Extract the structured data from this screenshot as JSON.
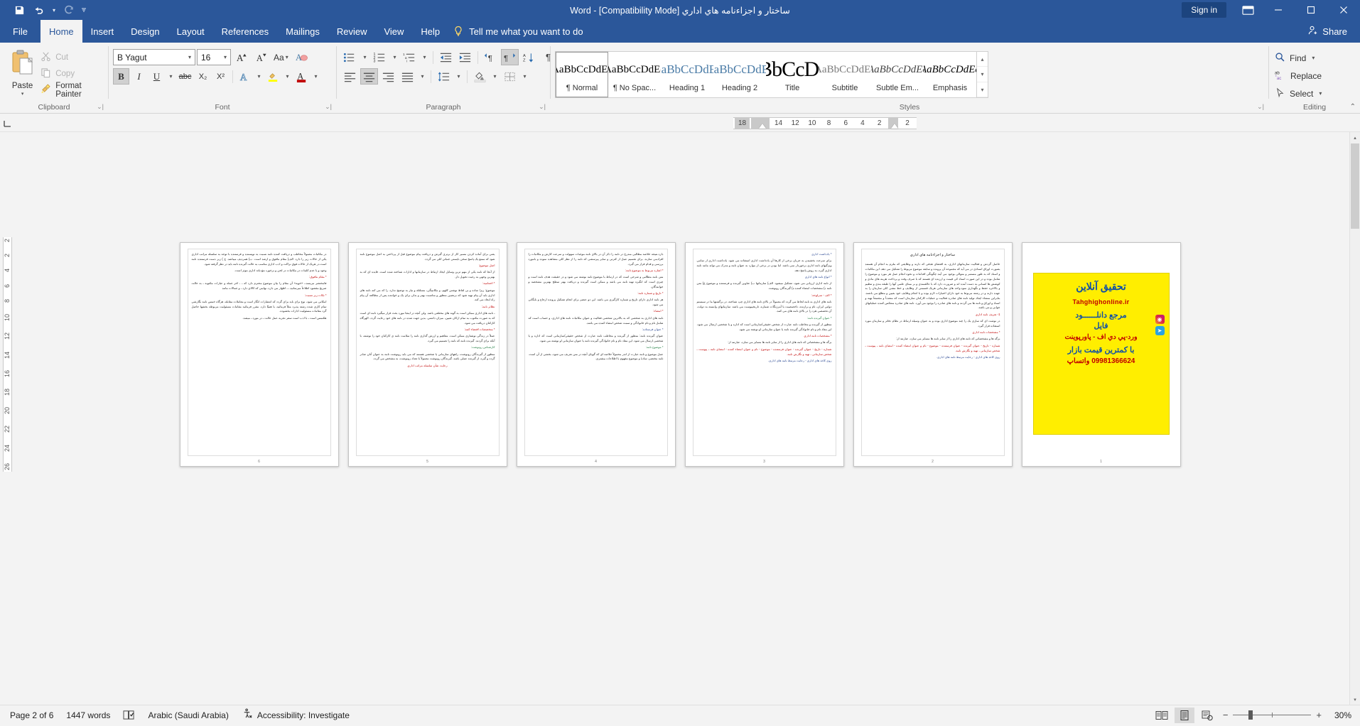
{
  "titlebar": {
    "quick_access": [
      {
        "name": "save-icon",
        "label": "Save"
      },
      {
        "name": "undo-icon",
        "label": "Undo"
      },
      {
        "name": "redo-icon",
        "label": "Redo"
      },
      {
        "name": "customize-qat-icon",
        "label": "Customize Quick Access Toolbar"
      }
    ],
    "document_title": "ساختار و اجزاءنامه هاي اداري [Compatibility Mode]  -  Word",
    "sign_in": "Sign in",
    "ribbon_display_options": "ribbon-display-options-icon",
    "minimize": "minimize-icon",
    "restore": "restore-icon",
    "close": "close-icon"
  },
  "tabs": [
    {
      "label": "File",
      "active": false
    },
    {
      "label": "Home",
      "active": true
    },
    {
      "label": "Insert",
      "active": false
    },
    {
      "label": "Design",
      "active": false
    },
    {
      "label": "Layout",
      "active": false
    },
    {
      "label": "References",
      "active": false
    },
    {
      "label": "Mailings",
      "active": false
    },
    {
      "label": "Review",
      "active": false
    },
    {
      "label": "View",
      "active": false
    },
    {
      "label": "Help",
      "active": false
    }
  ],
  "tell_me": "Tell me what you want to do",
  "share": "Share",
  "ribbon": {
    "clipboard": {
      "label": "Clipboard",
      "paste": "Paste",
      "cut": "Cut",
      "copy": "Copy",
      "format_painter": "Format Painter"
    },
    "font": {
      "label": "Font",
      "font_name": "B Yagut",
      "font_size": "16",
      "grow_font": "A",
      "shrink_font": "A",
      "change_case": "Aa",
      "clear_formatting": "clear-formatting-icon",
      "bold": "B",
      "italic": "I",
      "underline": "U",
      "strikethrough": "abc",
      "subscript": "X₂",
      "superscript": "X²",
      "text_effects": "A",
      "text_highlight": "highlight-icon",
      "font_color": "A"
    },
    "paragraph": {
      "label": "Paragraph",
      "bullets": "bullets-icon",
      "numbering": "numbering-icon",
      "multilevel": "multilevel-list-icon",
      "decrease_indent": "decrease-indent-icon",
      "increase_indent": "increase-indent-icon",
      "ltr": "left-to-right-icon",
      "rtl": "right-to-left-icon",
      "sort": "sort-icon",
      "show_marks": "¶",
      "align_left": "align-left-icon",
      "align_center": "align-center-icon",
      "align_right": "align-right-icon",
      "justify": "justify-icon",
      "line_spacing": "line-spacing-icon",
      "shading": "shading-icon",
      "borders": "borders-icon"
    },
    "styles": {
      "label": "Styles",
      "items": [
        {
          "preview": "AaBbCcDdEe",
          "name": "¶ Normal",
          "kind": "normal",
          "selected": true
        },
        {
          "preview": "AaBbCcDdEe",
          "name": "¶ No Spac...",
          "kind": "normal",
          "selected": false
        },
        {
          "preview": "AaBbCcDdEe",
          "name": "Heading 1",
          "kind": "heading",
          "selected": false
        },
        {
          "preview": "AaBbCcDdEe",
          "name": "Heading 2",
          "kind": "heading",
          "selected": false
        },
        {
          "preview": "AaBbCcDdEe",
          "name": "Title",
          "kind": "title",
          "selected": false
        },
        {
          "preview": "AaBbCcDdEe",
          "name": "Subtitle",
          "kind": "subtitle",
          "selected": false
        },
        {
          "preview": "AaBbCcDdEe",
          "name": "Subtle Em...",
          "kind": "em",
          "selected": false
        },
        {
          "preview": "AaBbCcDdEe",
          "name": "Emphasis",
          "kind": "em2",
          "selected": false
        }
      ]
    },
    "editing": {
      "label": "Editing",
      "find": "Find",
      "replace": "Replace",
      "select": "Select"
    },
    "collapse_ribbon": "collapse-ribbon-icon"
  },
  "ruler": {
    "ticks": [
      "18",
      "",
      "14",
      "12",
      "10",
      "8",
      "6",
      "4",
      "2",
      "",
      "2"
    ],
    "vertical_ticks": [
      "2",
      "2",
      "4",
      "6",
      "8",
      "10",
      "12",
      "14",
      "16",
      "18",
      "20",
      "22",
      "24",
      "26"
    ]
  },
  "statusbar": {
    "page": "Page 2 of 6",
    "words": "1447 words",
    "proofing_icon": "proofing-icon",
    "language": "Arabic (Saudi Arabia)",
    "accessibility": "Accessibility: Investigate",
    "views": [
      {
        "name": "read-mode-icon",
        "label": "Read Mode",
        "active": false
      },
      {
        "name": "print-layout-icon",
        "label": "Print Layout",
        "active": true
      },
      {
        "name": "web-layout-icon",
        "label": "Web Layout",
        "active": false
      }
    ],
    "zoom_out": "−",
    "zoom_in": "+",
    "zoom_value": "30%"
  },
  "document": {
    "pages": [
      {
        "number": "6",
        "title": "",
        "paragraphs": [
          {
            "text": "در مکاتبات معمولاً مخاطب و دریافت کننده نامه نسبت به نویسنده و فرستنده با توجه به سلسله مراتب اداری یکی از حالات زیر را دارد. الف) مقام مافوق و ارشد است.  ب) همردیف میباشد.  ج ) زیر دست فرستنده نامه است.در هریک از حالات فوق نزاکت و ادب اداری مناسب به حالت گیرنده نامه باید در نظر گرفته شود.",
            "color": "black"
          },
          {
            "text": "وجود و یا عدم کلمات در مکاتبات در لحن و برخورد مؤدبانه اداری موثر است.",
            "color": "black"
          },
          {
            "text": "* مقام مافوق:",
            "color": "red"
          },
          {
            "text": "فامختصر مریسدـ، «خویه» آن مقام را بیان موضوع محترم دارد که ـ ، اخر جمله و عبارات مکتوبه ـ به حالت صریح مقصود اطلاعاً میرسانید ـ ـ اظهار می دارد، نهایتی که کالای دارد ـ و جمالات مانند",
            "color": "black"
          },
          {
            "text": "* نکات زیر نسبت:",
            "color": "red"
          },
          {
            "text": "امکانی می شود، نوع برای باید برای گردد که انتشارات انگار است و معاملات مقابله، هرگاه خمس نامه نگارشی تمام کاری شده رشته پذیرد مثلاً فرمائید، یا همیّا دارد. مقرر فرمائید مقامات مسئولیت مربوطه بخشها حاصل گرد مقامات مسئولیت ادارات بخشوده.",
            "color": "black"
          },
          {
            "text": "هکتمس است ـ با ادب است  سفر تجربه عمل حالت ـ در مورد ـ میشد.",
            "color": "black"
          }
        ]
      },
      {
        "number": "5",
        "title": "",
        "paragraphs": [
          {
            "text": "یعنی برای آماده کردن مسیر کار از برتری گیرش و دریافت پیام موضوع قبل از پرداختن به اصل موضوع نامه شود که ممتع یک پاسخ سخن بایستی جنباتن کلی می گردد.",
            "color": "black"
          },
          {
            "text": "اصل موضوع:",
            "color": "red"
          },
          {
            "text": "از آنجا که نامه یکی از مهم ترین وسایل ایجاد ارتباط در سازمانها و ادارات شناخته شده است. فایده ای که به بهترین وجهی به رغبت تحویل دار.",
            "color": "black"
          },
          {
            "text": "* اختتامیه:",
            "color": "red"
          },
          {
            "text": "موضوع: زیرا ساده و بی لفاظ نوشتن کلهم، و مکاتیبگی، مسلئله و نیاز به توضیح ندارد. را که می کند نامه های اداری باید آن پیام تهیه شود که برتصین منظور و مناسبت بهتر و بدان برای یک و خواننده پس از مطالعه آن پیام راه ایجاد می کند.",
            "color": "black"
          },
          {
            "text": "نظائر نامه:",
            "color": "red"
          },
          {
            "text": "ـ نامه های اداری ممکن است به گونه های مختلفی باشد. ولی آنچه در اینجا مورد بحث قرار میگیرد نامه ای است که به صورت مکتوب به تمام ارکان تعیین، میزان داشتی. بدین جهت شده در نامه های خود رعایت گردد. الهرگاه کارکنان دریافت می شود.",
            "color": "black"
          },
          {
            "text": "* متخصصات اقتضاء کنند:",
            "color": "red"
          },
          {
            "text": "عملاً در زندگی نوشتاری ممکن است. مفاهیم و ارزش گذاری نامه را سلامت نامه ی کارکنان خود را نوشته، با آنکه برای گردند. گیرنده نامه که نامه را تصمیم می گیرد.",
            "color": "black"
          },
          {
            "text": "کارشناس رونوشت:",
            "color": "green"
          },
          {
            "text": "منظور از گیرندگان رونوشت، راههای سازمانی یا شخصی هستند که می باید رونوشت نامه به عنوان آنان صادر گردد و گیرد، از گیرنده عملی باشد. گیرندگان رونوشت معمولاً با تعداد  رونوشت، به مشخص می گردد.",
            "color": "black"
          },
          {
            "text": "رعایت شأن سلسله مراتب اداري",
            "color": "red"
          }
        ]
      },
      {
        "number": "4",
        "title": "",
        "paragraphs": [
          {
            "text": "دارد.نتیجه خلاصه مطالبی مندرج در نامه را ذکر آن در بالای نامه موجبات سهولت و سرعت کارش و مکاتبات را افرادمی سازند. برای تقسیم عمل از کثرتی و سایر پیرسشی که نامه را از نظر کلی مشاهده نموده و بامورد بررسی و قدام قرار می گیرد.",
            "color": "black"
          },
          {
            "text": "* اشاره مربوط به موضوع نامه:",
            "color": "red"
          },
          {
            "text": "متن نامه مطالبی و شرحی است که در ارتباط با موضوع نامه نوشته می شود و در حقیقت هدف نامه است و چیزی است که انگیزه تهیه نامه می باشد و ممکن است گیرنده و دریافت بهتر سطح بهترین مشخصه و خوانندگان.",
            "color": "black"
          },
          {
            "text": "* تاریخ و شماره نامه:",
            "color": "red"
          },
          {
            "text": "هر نامه اداری دارای تاریخ و شماره کارگیری می باشد. این دو عنصر برای انجام تشکیل پرونده ارجاع و بایگانی می شود.",
            "color": "black"
          },
          {
            "text": "* امضاء:",
            "color": "red"
          },
          {
            "text": "نامه های اداری به شخصی که به بالاترین شخصی فعالیت و عنوان مکاتبات نامه های اداری، و حساب است که شامل نام و نام خانوادگی و سمت شخص امضاء کننده می باشد.",
            "color": "black"
          },
          {
            "text": "* عنوان فرستاده:",
            "color": "blue"
          },
          {
            "text": "عنوان گیرنده نامه: منظور از گیرنده و مخاطب نامه عبارت از شخص حقیقی/سازمانی است که اداره و یا شخصی ارسال می شود. این مفاد نام و نام خانوادگی گیرنده نامه یا عنوان سازمانی او نوشته می شود.",
            "color": "black"
          },
          {
            "text": "* موضوع نامه:",
            "color": "green"
          },
          {
            "text": "عمل موضوع و نامه عبارت از اندر محمولاً خلاصه ای که گویای آنچه در متن تعریف می شود، بخشی از آن است. نامه مختصر، سادهٔ و موضوع مفهوم با اطلاعات بیشتری.",
            "color": "black"
          }
        ]
      },
      {
        "number": "3",
        "title": "",
        "paragraphs": [
          {
            "text": "* یادداشت اداری",
            "color": "blue"
          },
          {
            "text": "براي سرعت بخشیدن به جریان برخی از کارها آن یادداشت اداری استفاده می شود. یادداشت اداری از تمامی ویژگیهای نامه اداری برخوردار نمی باشد. اما بودن در برخی از موارد به عنوان نامه و مدرک می تواند مانند نامه اداری گیرد، به روش پاسخ دهد.",
            "color": "black"
          },
          {
            "text": "* انواع نامه هاي اداري",
            "color": "blue"
          },
          {
            "text": "از نامه اداری ارزیابی می شود، تشکیل میشود. الف) سازمانها ب) عناوین گیرنده و فرستنده    و موضوع  ج) متن نامه  د) مشخصات  امضاء  کننده  ه) گیرندگان رونوشت",
            "color": "black"
          },
          {
            "text": "* الف - سرلوحه:",
            "color": "red"
          },
          {
            "text": "نامه های اداری به نامه لحاظ می گردد که معمولاً در بالای نامه های اداری چپ شناخته. در برگشتها ما در سیستم دولتی ایران، نام و برازنده، ناخصصیت یا آمرژنگات شماره، تاریخپیوست می باشد. سازمانهای وابسته به دولت، آن تخصصی هرد را در بالای نامه های می کنند.",
            "color": "black"
          },
          {
            "text": "* عنوان گیرنده نامه:",
            "color": "green"
          },
          {
            "text": "منظور از گیرنده و مخاطب نامه عبارت از شخص حقیقی/سازمانی است که اداره و یا شخصی ارسال می شود. این مفاد نام و نام خانوادگی گیرنده نامه یا عنوان سازمانی او نوشته می شود.",
            "color": "black"
          },
          {
            "text": "* مشخصات نامه اداري",
            "color": "red"
          },
          {
            "text": "برگه ها و مشخصاتی که نامه های اداری را از سایر نامه ها متمایز می سازد، عبارتند از:",
            "color": "black"
          },
          {
            "text": "شماره - تاریخ - عنوان گیرنده - عنوان فرستنده - موضوع - نام و عنوان امضاء کننده - امضای نامه ـ پیوست ـ شخص سازمانی ـ تهیه و نگارش نامه.",
            "color": "red"
          },
          {
            "text": "روی کاغذ های اداری - رعایت مرتبط نامه های اداری.",
            "color": "blue"
          }
        ]
      },
      {
        "number": "2",
        "title": "ساختار و اجزاءنامه هاي اداري",
        "paragraphs": [
          {
            "text": "حاصل گردش و فعالیت سازمانهای اداری، به اقتضای هدفی که دارند و وظایفی که ملزم به انجام آن هستند بصورت اوراق اسنادی در می آید که مجموعه آن پرونده و سابقه موضوع مربوط را تشکیل می دهد. این مکاتبات و اسناد که به طور مستمر و متوالی بوجود می آیند چگونگی اقدامات و نحوه انجام عمل هر مورد و موضوع را شامل بوده و در این صورت اسناد کی قیمت و ارزنده ای هستند که با صرف وقت و پرداخت هزینه های مادی و کوشش ها انسانی به دست آمده اند و ضرورت دارد که با عالقمندی و بر مبنای علمی آنها را طبقه بندی و تنظیم و بالاخره حفظ و نگهداری نمود.واحد های سازمانی هریک قسمتی از وظایف و خط مشی کلی سازمان را به عهده دارند و در رشته مربوط به خود دارای اختیارات لازم بوده و با انجام وظایف خود بعیین و مطلع می باشند. بنابراین منشاء ایجاد تولید نامه های صادره فعالیت و عملیات کارکنان سازمان است که متعدداً و مجتمعاً تهیه و اسناد و اوراق و نامه ها می گردند و نامه های صادره را بوجود می آورد. نامه های صادره منعکس کننده عملیاتهای جوابی و می باشد.",
            "color": "black"
          },
          {
            "text": "1- تعریف نامه اداري",
            "color": "red"
          },
          {
            "text": "در نوشت ای که سازی یک را چند موضوع اداری بوده و به عنوان وسیله ارتباط در نظام دفاتر و سازمان مورد استفاده قرار گیرد.",
            "color": "black"
          },
          {
            "text": "* مشخصات نامه اداري",
            "color": "red"
          },
          {
            "text": "برگه ها و مشخصاتی که نامه های اداری را از سایر نامه ها متمایز می سازد، عبارتند از:",
            "color": "black"
          },
          {
            "text": "شماره - تاریخ - عنوان گیرنده - عنوان فرستنده - موضوع - نام و عنوان امضاء کننده - امضای نامه ـ پیوست ـ شخص سازمانی ـ تهیه و نگارش نامه.",
            "color": "red"
          },
          {
            "text": "روی کاغذ های اداری - رعایت مرتبط نامه های اداری.",
            "color": "blue"
          }
        ]
      },
      {
        "number": "1",
        "title": "",
        "is_ad": true,
        "ad": {
          "brand": "تحقيق آنلاين",
          "site": "Tahghighonline.ir",
          "line1": "مرجع دانلــــــود",
          "line2": "فايل",
          "line3": "ورد-پي دي اف - پاورپوينت",
          "line4": "با كمترين قيمت بازار",
          "line5": "09981366624 واتساپ",
          "icons": [
            "instagram-icon",
            "telegram-icon"
          ]
        }
      }
    ]
  }
}
